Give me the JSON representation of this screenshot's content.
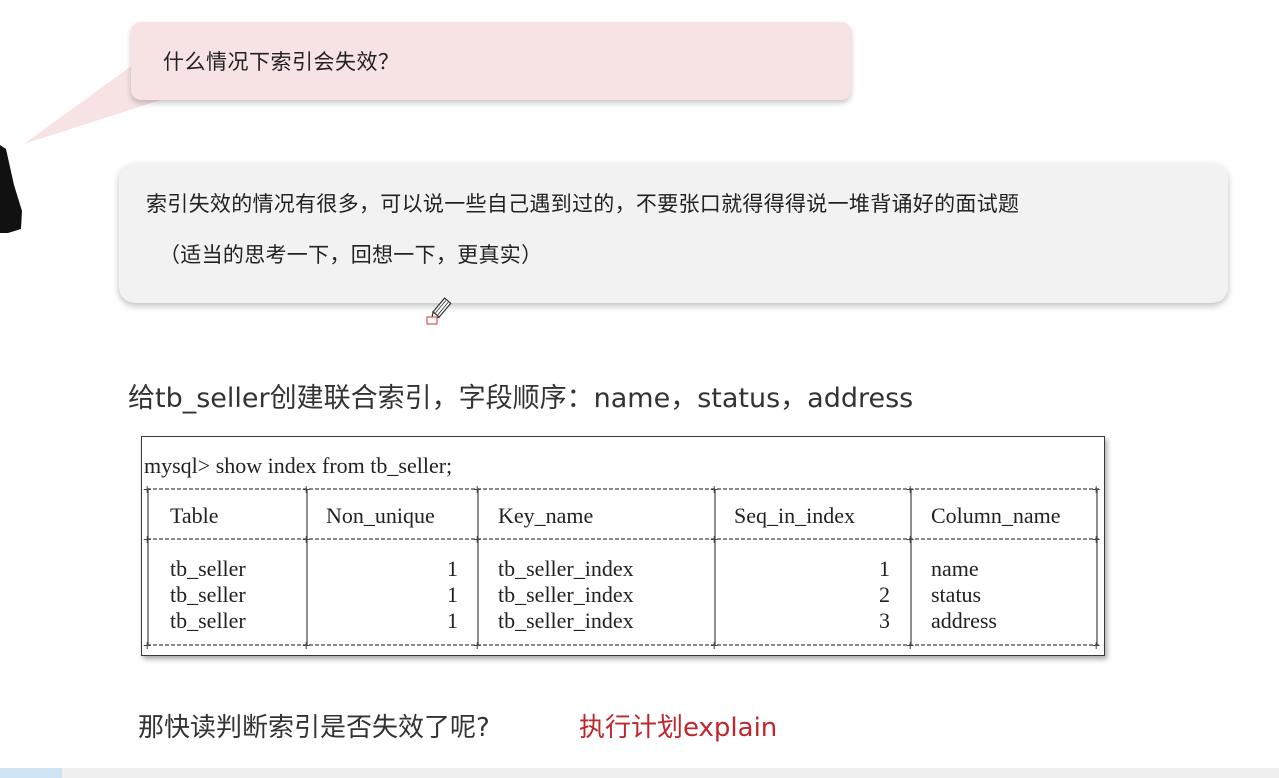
{
  "question": "什么情况下索引会失效？",
  "answer": {
    "line1": "索引失效的情况有很多，可以说一些自己遇到过的，不要张口就得得得说一堆背诵好的面试题",
    "line2": "（适当的思考一下，回想一下，更真实）"
  },
  "heading": "给tb_seller创建联合索引，字段顺序：name，status，address",
  "terminal": {
    "command": "mysql> show index from tb_seller;",
    "columns": [
      "Table",
      "Non_unique",
      "Key_name",
      "Seq_in_index",
      "Column_name"
    ],
    "rows": [
      [
        "tb_seller",
        "1",
        "tb_seller_index",
        "1",
        "name"
      ],
      [
        "tb_seller",
        "1",
        "tb_seller_index",
        "2",
        "status"
      ],
      [
        "tb_seller",
        "1",
        "tb_seller_index",
        "3",
        "address"
      ]
    ]
  },
  "bottom": {
    "question": "那快读判断索引是否失效了呢?",
    "answer": "执行计划explain"
  },
  "colors": {
    "question_bubble": "#f7e3e3",
    "answer_bubble": "#f2f2f2",
    "accent_red": "#c0272d"
  }
}
